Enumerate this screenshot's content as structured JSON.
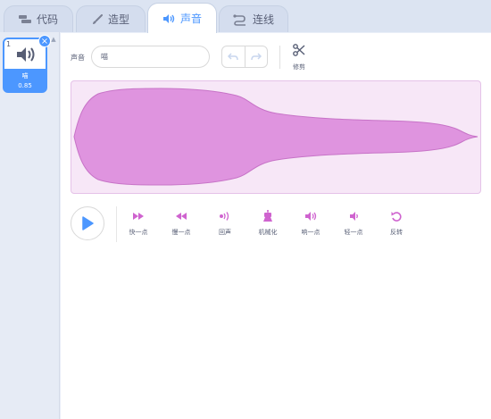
{
  "tabs": [
    {
      "id": "code",
      "label": "代码",
      "icon": "code-blocks-icon"
    },
    {
      "id": "costumes",
      "label": "造型",
      "icon": "paintbrush-icon"
    },
    {
      "id": "sounds",
      "label": "声音",
      "icon": "speaker-icon",
      "active": true
    },
    {
      "id": "connect",
      "label": "连线",
      "icon": "wire-icon"
    }
  ],
  "sound_list": [
    {
      "index": "1",
      "name": "喵",
      "duration": "0.85",
      "selected": true
    }
  ],
  "editor": {
    "name_label": "声音",
    "name_value": "喵",
    "trim_label": "修剪"
  },
  "effects": [
    {
      "label": "快一点",
      "icon": "faster-icon"
    },
    {
      "label": "慢一点",
      "icon": "slower-icon"
    },
    {
      "label": "回声",
      "icon": "echo-icon"
    },
    {
      "label": "机械化",
      "icon": "robot-icon"
    },
    {
      "label": "响一点",
      "icon": "louder-icon"
    },
    {
      "label": "轻一点",
      "icon": "softer-icon"
    },
    {
      "label": "反转",
      "icon": "reverse-icon"
    }
  ],
  "colors": {
    "accent": "#4c97ff",
    "sound_purple": "#cf63cf",
    "waveform_fill": "#df94df",
    "waveform_bg": "#f7e7f7"
  }
}
